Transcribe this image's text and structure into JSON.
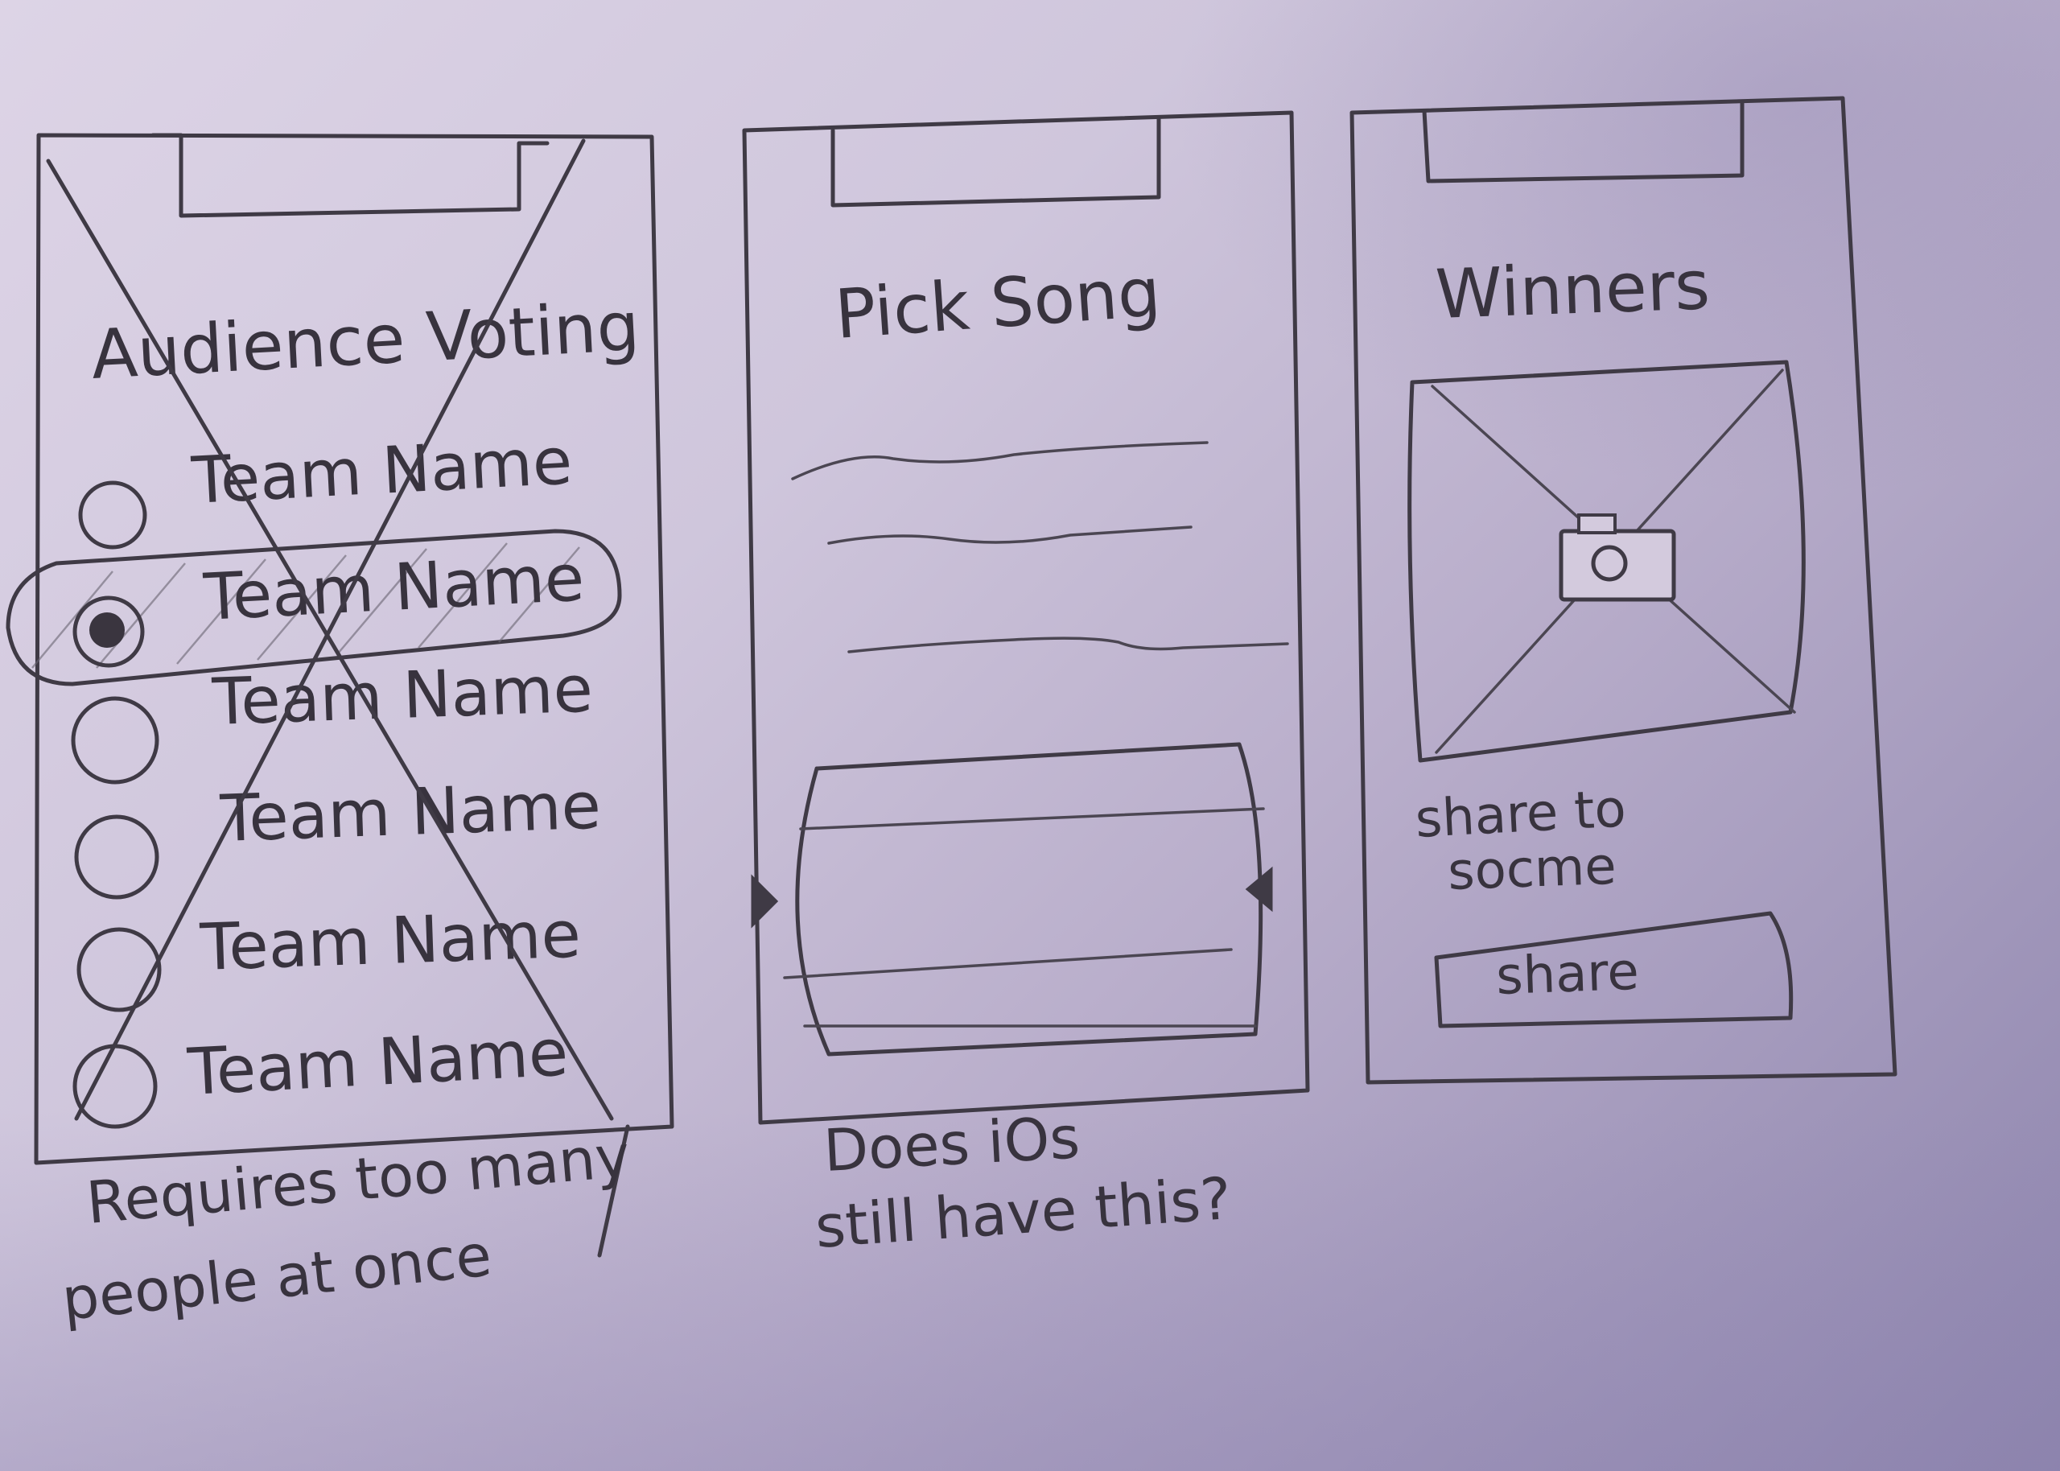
{
  "screens": [
    {
      "title": "Audience Voting",
      "items": [
        "Team Name",
        "Team Name",
        "Team Name",
        "Team Name",
        "Team Name",
        "Team Name"
      ],
      "selected_index": 1,
      "crossed_out": true,
      "note_line1": "Requires too many",
      "note_line2": "people at once"
    },
    {
      "title": "Pick Song",
      "note_line1": "Does iOs",
      "note_line2": "still have this?"
    },
    {
      "title": "Winners",
      "photo_icon": "camera-icon",
      "caption_line1": "share to",
      "caption_line2": "socme",
      "button_label": "share"
    }
  ],
  "colors": {
    "ink": "#3f3a45",
    "paper": "#d8cfe2"
  }
}
